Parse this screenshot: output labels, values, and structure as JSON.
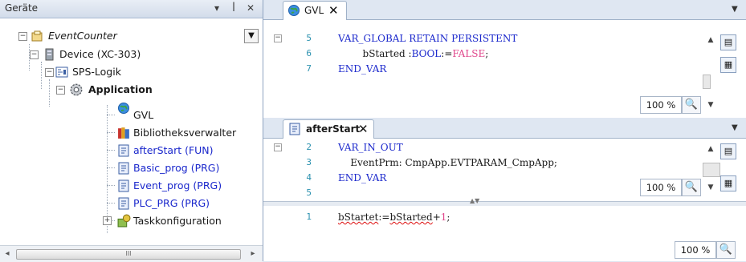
{
  "devices_panel": {
    "title": "Geräte",
    "title_buttons": [
      "▾",
      "ꟾ",
      "✕"
    ],
    "tree": [
      {
        "label": "EventCounter",
        "icon": "project-icon"
      },
      {
        "label": "Device (XC-303)",
        "icon": "plc-device-icon"
      },
      {
        "label": "SPS-Logik",
        "icon": "plc-logic-icon"
      },
      {
        "label": "Application",
        "icon": "application-gear-icon"
      },
      {
        "label": "GVL",
        "icon": "globe-gvl-icon"
      },
      {
        "label": "Bibliotheksverwalter",
        "icon": "library-books-icon"
      },
      {
        "label": "afterStart (FUN)",
        "icon": "pou-page-icon"
      },
      {
        "label": "Basic_prog (PRG)",
        "icon": "pou-page-icon"
      },
      {
        "label": "Event_prog (PRG)",
        "icon": "pou-page-icon"
      },
      {
        "label": "PLC_PRG (PRG)",
        "icon": "pou-page-icon"
      },
      {
        "label": "Taskkonfiguration",
        "icon": "task-config-icon"
      }
    ],
    "scroll_thumb_text": "III"
  },
  "gvl_editor": {
    "tab_label": "GVL",
    "tab_close": "✕",
    "lines": [
      {
        "num": "5",
        "parts": [
          {
            "t": "VAR_GLOBAL RETAIN PERSISTENT",
            "c": "kw"
          }
        ]
      },
      {
        "num": "6",
        "parts": [
          {
            "t": "        bStarted :",
            "c": ""
          },
          {
            "t": "BOOL",
            "c": "kw"
          },
          {
            "t": ":=",
            "c": ""
          },
          {
            "t": "FALSE",
            "c": "lit"
          },
          {
            "t": ";",
            "c": ""
          }
        ]
      },
      {
        "num": "7",
        "parts": [
          {
            "t": "END_VAR",
            "c": "kw"
          }
        ]
      }
    ],
    "zoom": "100 %"
  },
  "afterstart_editor": {
    "tab_label": "afterStart",
    "tab_close": "✕",
    "decl_lines": [
      {
        "num": "2",
        "parts": [
          {
            "t": "VAR_IN_OUT",
            "c": "kw"
          }
        ]
      },
      {
        "num": "3",
        "parts": [
          {
            "t": "    EventPrm: CmpApp.EVTPARAM_CmpApp;",
            "c": ""
          }
        ]
      },
      {
        "num": "4",
        "parts": [
          {
            "t": "END_VAR",
            "c": "kw"
          }
        ]
      },
      {
        "num": "5",
        "parts": []
      }
    ],
    "decl_zoom": "100 %",
    "impl_lines": [
      {
        "num": "1",
        "parts": [
          {
            "t": "bStartet",
            "c": "squiggle"
          },
          {
            "t": ":=",
            "c": ""
          },
          {
            "t": "bStarted",
            "c": "squiggle"
          },
          {
            "t": "+",
            "c": ""
          },
          {
            "t": "1",
            "c": "lit"
          },
          {
            "t": ";",
            "c": ""
          }
        ]
      }
    ],
    "impl_zoom": "100 %"
  },
  "colors": {
    "keyword": "#1b28cc",
    "literal": "#e0478c",
    "line_number": "#2b91af",
    "error_squiggle": "#dd1111"
  }
}
